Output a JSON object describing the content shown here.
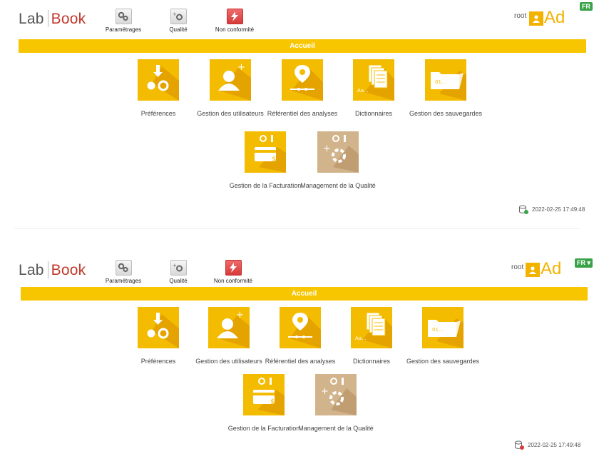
{
  "screens": [
    {
      "logo": {
        "lab": "Lab",
        "book": "Book"
      },
      "nav": [
        {
          "label": "Paramétrages",
          "icon": "gears-icon"
        },
        {
          "label": "Qualité",
          "icon": "quality-gear-icon"
        },
        {
          "label": "Non conformité",
          "icon": "bolt-icon"
        }
      ],
      "user": {
        "name": "root",
        "avatar_text": "Ad",
        "lang": "FR"
      },
      "banner": "Accueil",
      "tiles_row1": [
        {
          "label": "Préférences",
          "icon": "preferences-icon"
        },
        {
          "label": "Gestion des utilisateurs",
          "icon": "add-user-icon"
        },
        {
          "label": "Référentiel des analyses",
          "icon": "map-pin-icon"
        },
        {
          "label": "Dictionnaires",
          "icon": "documents-icon",
          "icon_text": "Aa..."
        },
        {
          "label": "Gestion des sauvegardes",
          "icon": "folder-icon",
          "icon_text": "01..."
        }
      ],
      "tiles_row2": [
        {
          "label": "Gestion de la Facturation",
          "icon": "credit-card-icon"
        },
        {
          "label": "Management de la Qualité",
          "icon": "quality-management-icon"
        }
      ],
      "timestamp": "2022-02-25 17:49:48",
      "db_status": "green"
    },
    {
      "logo": {
        "lab": "Lab",
        "book": "Book"
      },
      "nav": [
        {
          "label": "Paramétrages",
          "icon": "gears-icon"
        },
        {
          "label": "Qualité",
          "icon": "quality-gear-icon"
        },
        {
          "label": "Non conformité",
          "icon": "bolt-icon"
        }
      ],
      "user": {
        "name": "root",
        "avatar_text": "Ad",
        "lang": "FR"
      },
      "banner": "Accueil",
      "tiles_row1": [
        {
          "label": "Préférences",
          "icon": "preferences-icon"
        },
        {
          "label": "Gestion des utilisateurs",
          "icon": "add-user-icon"
        },
        {
          "label": "Référentiel des analyses",
          "icon": "map-pin-icon"
        },
        {
          "label": "Dictionnaires",
          "icon": "documents-icon",
          "icon_text": "Aa..."
        },
        {
          "label": "Gestion des sauvegardes",
          "icon": "folder-icon",
          "icon_text": "01..."
        }
      ],
      "tiles_row2": [
        {
          "label": "Gestion de la Facturation",
          "icon": "credit-card-icon"
        },
        {
          "label": "Management de la Qualité",
          "icon": "quality-management-icon"
        }
      ],
      "timestamp": "2022-02-25 17:49:48",
      "db_status": "red"
    }
  ],
  "colors": {
    "accent": "#f7c600",
    "tile": "#f4bc00",
    "tile_alt": "#d2b48c",
    "book": "#c0392b",
    "db_ok": "#3aa34a",
    "db_error": "#d63a3a"
  }
}
